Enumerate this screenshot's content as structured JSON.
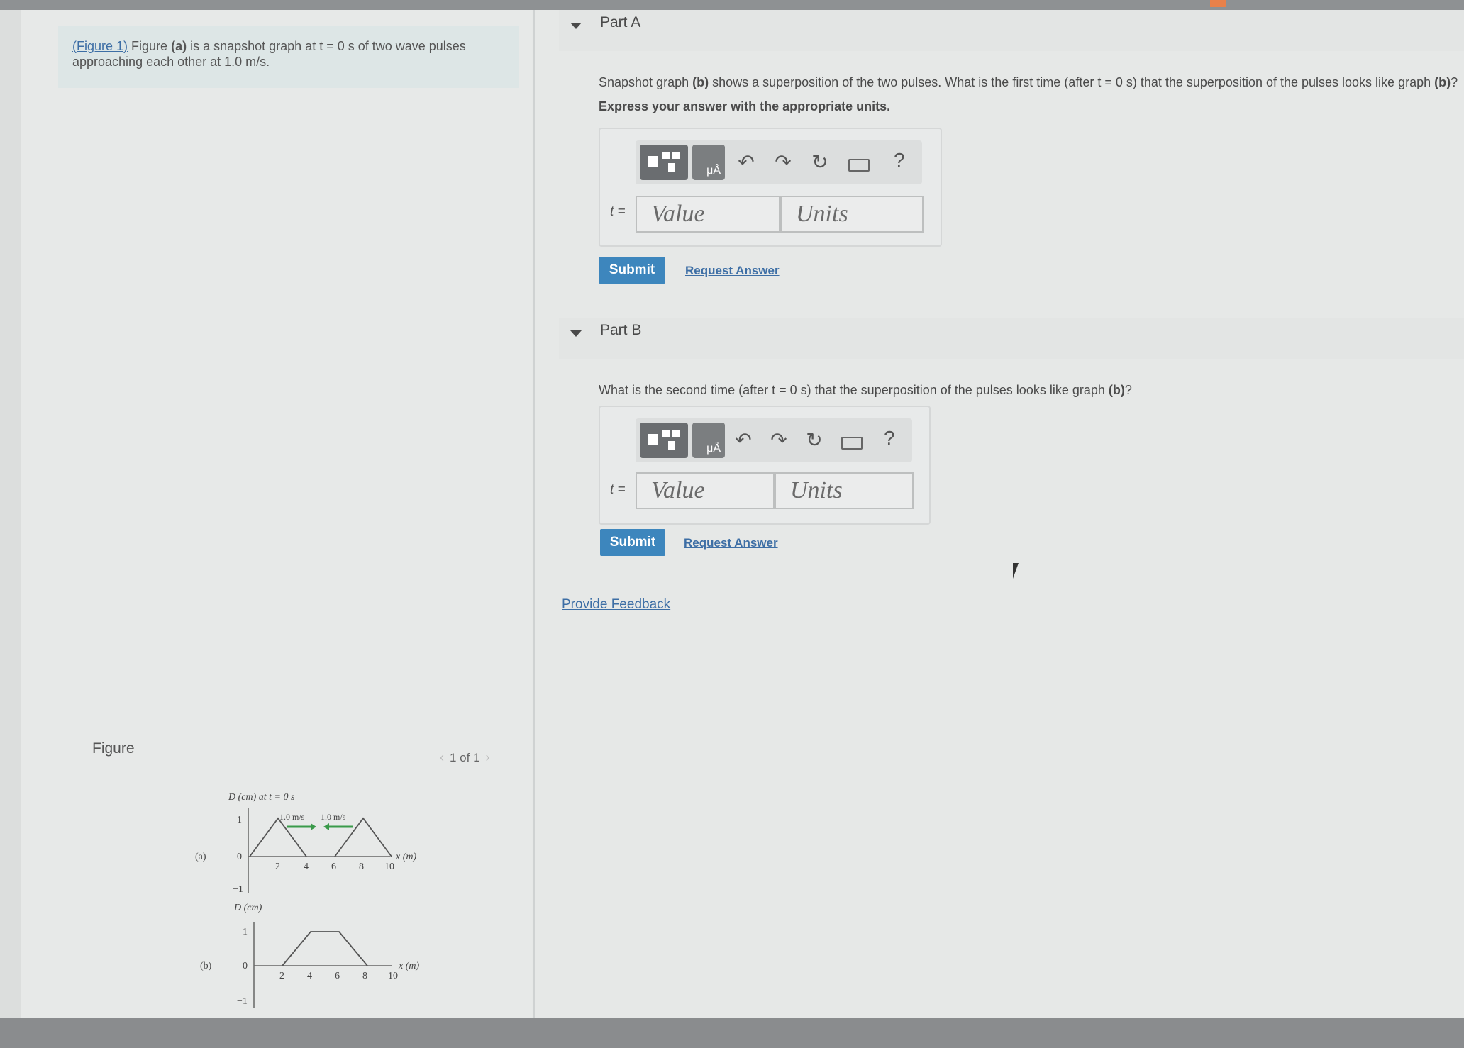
{
  "intro": {
    "figure_link": "(Figure 1)",
    "text_pre": "Figure ",
    "fig_a": "(a)",
    "text_post": " is a snapshot graph at t = 0 s of two wave pulses approaching each other at 1.0 m/s."
  },
  "figure": {
    "title": "Figure",
    "page_indicator": "1 of 1",
    "graph_a": {
      "label": "(a)",
      "ylabel": "D (cm) at t = 0 s",
      "xlabel": "x (m)",
      "y_ticks": [
        "1",
        "0",
        "−1"
      ],
      "x_ticks": [
        "2",
        "4",
        "6",
        "8",
        "10"
      ],
      "speed_left": "1.0 m/s",
      "speed_right": "1.0 m/s"
    },
    "graph_b": {
      "label": "(b)",
      "ylabel": "D (cm)",
      "xlabel": "x (m)",
      "y_ticks": [
        "1",
        "0",
        "−1"
      ],
      "x_ticks": [
        "2",
        "4",
        "6",
        "8",
        "10"
      ]
    }
  },
  "partA": {
    "title": "Part A",
    "question_pre": "Snapshot graph ",
    "question_b": "(b)",
    "question_mid": " shows a superposition of the two pulses. What is the first time (after t = 0 s) that the superposition of the pulses looks like graph ",
    "question_b2": "(b)",
    "question_end": "?",
    "instruction": "Express your answer with the appropriate units.",
    "var_label": "t =",
    "value_placeholder": "Value",
    "units_placeholder": "Units",
    "submit": "Submit",
    "request": "Request Answer"
  },
  "partB": {
    "title": "Part B",
    "question_pre": "What is the second time (after t = 0 s) that the superposition of the pulses looks like graph ",
    "question_b": "(b)",
    "question_end": "?",
    "var_label": "t =",
    "value_placeholder": "Value",
    "units_placeholder": "Units",
    "submit": "Submit",
    "request": "Request Answer"
  },
  "toolbar": {
    "unit_glyph": "μÅ",
    "undo": "↶",
    "redo": "↷",
    "reset": "↻",
    "help": "?"
  },
  "feedback": "Provide Feedback",
  "colors": {
    "accent": "#3d86bd",
    "link": "#3d6ea5",
    "arrow": "#3a9a4a"
  }
}
